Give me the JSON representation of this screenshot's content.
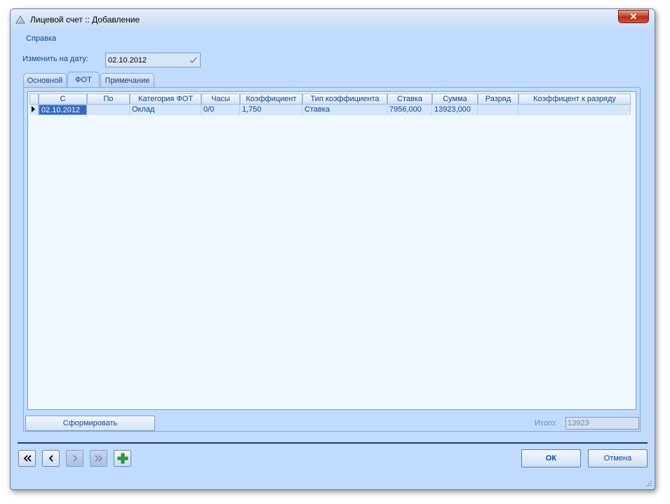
{
  "window": {
    "title": "Лицевой счет :: Добавление",
    "close_glyph": "✕"
  },
  "menu": {
    "items": [
      {
        "label": "Справка"
      }
    ]
  },
  "date_filter": {
    "label": "Изменить на дату:",
    "value": "02.10.2012"
  },
  "tabs": [
    {
      "label": "Основной",
      "active": false
    },
    {
      "label": "ФОТ",
      "active": true
    },
    {
      "label": "Примечание",
      "active": false
    }
  ],
  "grid": {
    "columns": [
      "С",
      "По",
      "Категория ФОТ",
      "Часы",
      "Коэффициент",
      "Тип коэффициента",
      "Ставка",
      "Сумма",
      "Разряд",
      "Коэффицент к разряду"
    ],
    "rows": [
      [
        "02.10.2012",
        "",
        "Оклад",
        "0/0",
        "1,750",
        "Ставка",
        "7956,000",
        "13923,000",
        "",
        ""
      ]
    ]
  },
  "footer": {
    "form_button": "Сформировать",
    "total_label": "Итого:",
    "total_value": "13923"
  },
  "nav": {
    "first_icon": "double-chevron-left-icon",
    "prev_icon": "chevron-left-icon",
    "next_icon": "chevron-right-icon",
    "last_icon": "double-chevron-right-icon",
    "add_icon": "plus-icon"
  },
  "buttons": {
    "ok": "ОК",
    "cancel": "Отмена"
  },
  "colors": {
    "accent": "#15428b",
    "window_bg": "#bfdbff",
    "grid_bg": "#eff8ff",
    "selection": "#3169c6",
    "separator": "#1c3d78"
  }
}
